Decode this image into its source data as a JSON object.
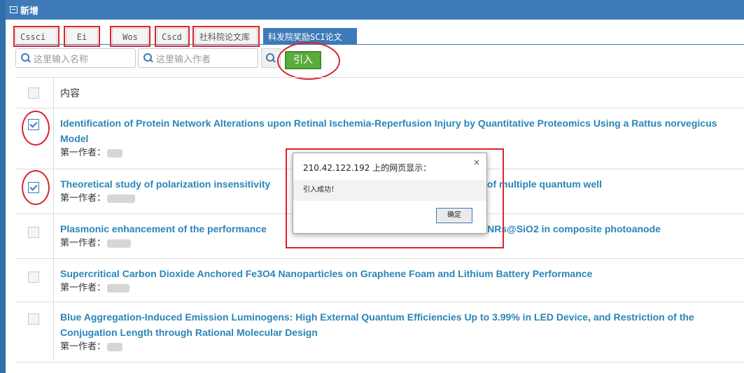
{
  "window": {
    "title": "新增"
  },
  "tabs": [
    {
      "label": "Cssci",
      "active": false,
      "marked": true
    },
    {
      "label": "Ei",
      "active": false,
      "marked": true
    },
    {
      "label": "Wos",
      "active": false,
      "marked": true
    },
    {
      "label": "Cscd",
      "active": false,
      "marked": true
    },
    {
      "label": "社科院论文库",
      "active": false,
      "marked": true
    },
    {
      "label": "科发院奖励SCI论文",
      "active": true,
      "marked": false
    }
  ],
  "search": {
    "name_placeholder": "这里输入名称",
    "author_placeholder": "这里输入作者",
    "import_label": "引入"
  },
  "table": {
    "header": "内容",
    "author_prefix": "第一作者：",
    "rows": [
      {
        "title": "Identification of Protein Network Alterations upon Retinal Ischemia-Reperfusion Injury by Quantitative Proteomics Using a Rattus norvegicus Model",
        "checked": true
      },
      {
        "title": "Theoretical study of polarization insensitivity                                                                  change of multiple quantum well",
        "checked": true
      },
      {
        "title": "Plasmonic enhancement of the performance                                                                  -shell AuNRs@SiO2 in composite photoanode",
        "checked": false
      },
      {
        "title": "Supercritical Carbon Dioxide Anchored Fe3O4 Nanoparticles on Graphene Foam and Lithium Battery Performance",
        "checked": false
      },
      {
        "title": "Blue Aggregation-Induced Emission Luminogens: High External Quantum Efficiencies Up to 3.99% in LED Device, and Restriction of the Conjugation Length through Rational Molecular Design",
        "checked": false
      }
    ]
  },
  "dialog": {
    "title": "210.42.122.192 上的网页显示：",
    "close": "×",
    "message": "引入成功！",
    "ok_label": "确定"
  },
  "colors": {
    "accent": "#3d7ab7",
    "link": "#2a85b8",
    "import_green": "#5cab3e",
    "annotation_red": "#d9232e"
  }
}
